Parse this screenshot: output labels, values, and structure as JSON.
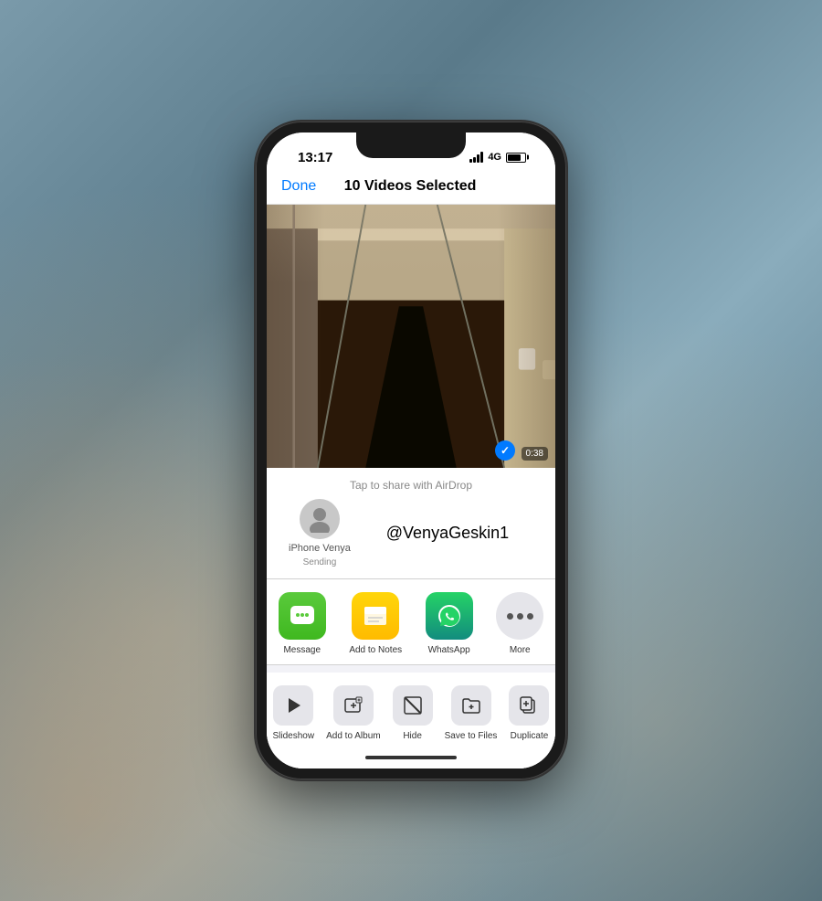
{
  "status_bar": {
    "time": "13:17",
    "network": "4G"
  },
  "top_bar": {
    "done_label": "Done",
    "title": "10 Videos Selected"
  },
  "photo": {
    "duration": "0:38"
  },
  "airdrop": {
    "tap_label": "Tap to share with AirDrop",
    "device_name": "iPhone Venya",
    "device_status": "Sending",
    "username": "@VenyaGeskin1"
  },
  "apps": [
    {
      "id": "message",
      "label": "Message"
    },
    {
      "id": "notes",
      "label": "Add to Notes"
    },
    {
      "id": "whatsapp",
      "label": "WhatsApp"
    },
    {
      "id": "more",
      "label": "More"
    }
  ],
  "actions": [
    {
      "id": "slideshow",
      "label": "Slideshow"
    },
    {
      "id": "add-album",
      "label": "Add to Album"
    },
    {
      "id": "hide",
      "label": "Hide"
    },
    {
      "id": "save-files",
      "label": "Save to Files"
    },
    {
      "id": "duplicate",
      "label": "Duplicate"
    }
  ]
}
